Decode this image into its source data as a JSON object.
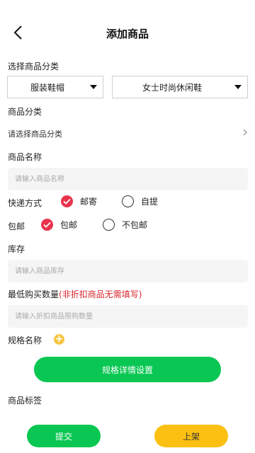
{
  "header": {
    "title": "添加商品"
  },
  "category_select": {
    "label": "选择商品分类",
    "primary": "服装鞋帽",
    "secondary": "女士时尚休闲鞋"
  },
  "product_category": {
    "label": "商品分类",
    "placeholder": "请选择商品分类"
  },
  "product_name": {
    "label": "商品名称",
    "placeholder": "请输入商品名称"
  },
  "delivery": {
    "label": "快递方式",
    "options": [
      {
        "label": "邮寄",
        "checked": true
      },
      {
        "label": "自提",
        "checked": false
      }
    ]
  },
  "free_shipping": {
    "label": "包邮",
    "options": [
      {
        "label": "包邮",
        "checked": true
      },
      {
        "label": "不包邮",
        "checked": false
      }
    ]
  },
  "stock": {
    "label": "库存",
    "placeholder": "请输入商品库存"
  },
  "min_purchase": {
    "label": "最低购买数量",
    "note": "(非折扣商品无需填写)",
    "placeholder": "请输入折扣商品限购数量"
  },
  "spec": {
    "label": "规格名称",
    "add_icon": "+",
    "button": "规格详情设置"
  },
  "tags": {
    "label": "商品标签"
  },
  "actions": {
    "submit": "提交",
    "shelf": "上架"
  },
  "colors": {
    "green": "#09c752",
    "yellow": "#fbc012",
    "radio_checked": "#e8334d",
    "note_red": "#d6242a"
  }
}
